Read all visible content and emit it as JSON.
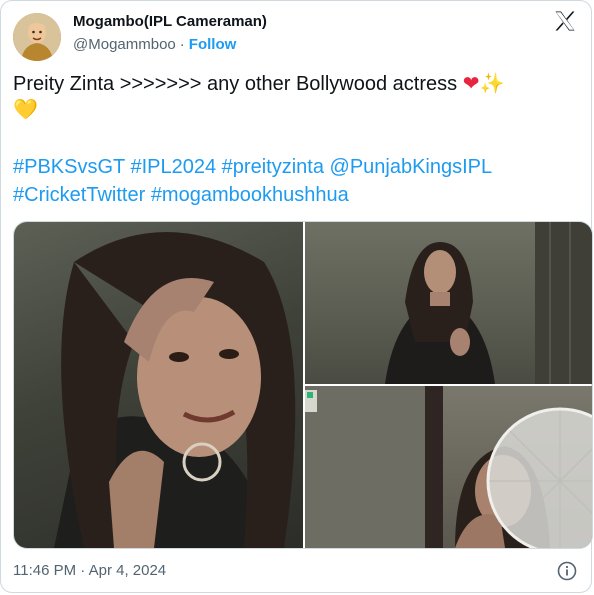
{
  "author": {
    "display_name": "Mogambo(IPL Cameraman)",
    "handle": "@Mogammboo",
    "follow_label": "Follow",
    "avatar_icon": "avatar-image"
  },
  "platform_logo": "x-logo-icon",
  "tweet": {
    "text": "Preity Zinta >>>>>>> any other Bollywood actress",
    "emojis": [
      "❤",
      "✨",
      "💛"
    ],
    "hashtags": [
      "#PBKSvsGT",
      "#IPL2024",
      "#preityzinta",
      "@PunjabKingsIPL",
      "#CricketTwitter",
      "#mogambookhushhua"
    ]
  },
  "media": {
    "count": 3
  },
  "timestamp": "11:46 PM · Apr 4, 2024",
  "colors": {
    "link": "#1d9bf0",
    "text": "#0f1419",
    "muted": "#536471",
    "border": "#cfd9de"
  }
}
